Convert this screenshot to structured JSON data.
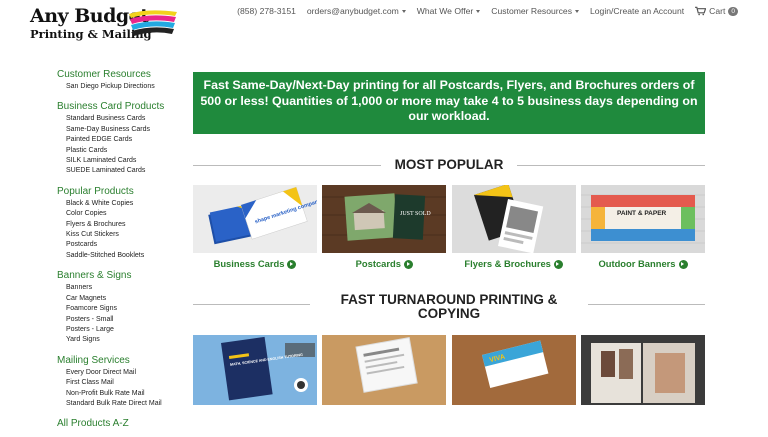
{
  "logo": {
    "line1": "Any Budget",
    "line2": "Printing & Mailing"
  },
  "topnav": {
    "phone": "(858) 278-3151",
    "email": "orders@anybudget.com",
    "what_we_offer": "What We Offer",
    "customer_resources": "Customer Resources",
    "login": "Login/Create an Account",
    "cart": "Cart",
    "cart_count": "0"
  },
  "sidebar": {
    "groups": [
      {
        "heading": "Customer Resources",
        "links": [
          "San Diego Pickup Directions"
        ]
      },
      {
        "heading": "Business Card Products",
        "links": [
          "Standard Business Cards",
          "Same-Day Business Cards",
          "Painted EDGE Cards",
          "Plastic Cards",
          "SILK Laminated Cards",
          "SUEDE Laminated Cards"
        ]
      },
      {
        "heading": "Popular Products",
        "links": [
          "Black & White Copies",
          "Color Copies",
          "Flyers & Brochures",
          "Kiss Cut Stickers",
          "Postcards",
          "Saddle-Stitched Booklets"
        ]
      },
      {
        "heading": "Banners & Signs",
        "links": [
          "Banners",
          "Car Magnets",
          "Foamcore Signs",
          "Posters - Small",
          "Posters - Large",
          "Yard Signs"
        ]
      },
      {
        "heading": "Mailing Services",
        "links": [
          "Every Door Direct Mail",
          "First Class Mail",
          "Non-Profit Bulk Rate Mail",
          "Standard Bulk Rate Direct Mail"
        ]
      },
      {
        "heading": "All Products A-Z",
        "links": []
      }
    ]
  },
  "banner": "Fast Same-Day/Next-Day printing for all Postcards, Flyers, and Brochures orders of 500 or less! Quantities of 1,000 or more may take 4 to 5 business days depending on our workload.",
  "most_popular": {
    "title": "MOST POPULAR",
    "cards": [
      {
        "label": "Business Cards",
        "img_text": "shape marketing company"
      },
      {
        "label": "Postcards",
        "img_text": "JUST SOLD"
      },
      {
        "label": "Flyers & Brochures"
      },
      {
        "label": "Outdoor Banners",
        "img_text": "PAINT & PAPER"
      }
    ]
  },
  "fast_turnaround": {
    "title_line1": "FAST TURNAROUND PRINTING &",
    "title_line2": "COPYING",
    "cards": [
      {
        "img_text": "MATH, SCIENCE AND ENGLISH TUTORING"
      },
      {},
      {
        "img_text": "VIVA"
      },
      {}
    ]
  },
  "colors": {
    "brand_green": "#2a7f2e",
    "banner_green": "#1f8a3d"
  }
}
